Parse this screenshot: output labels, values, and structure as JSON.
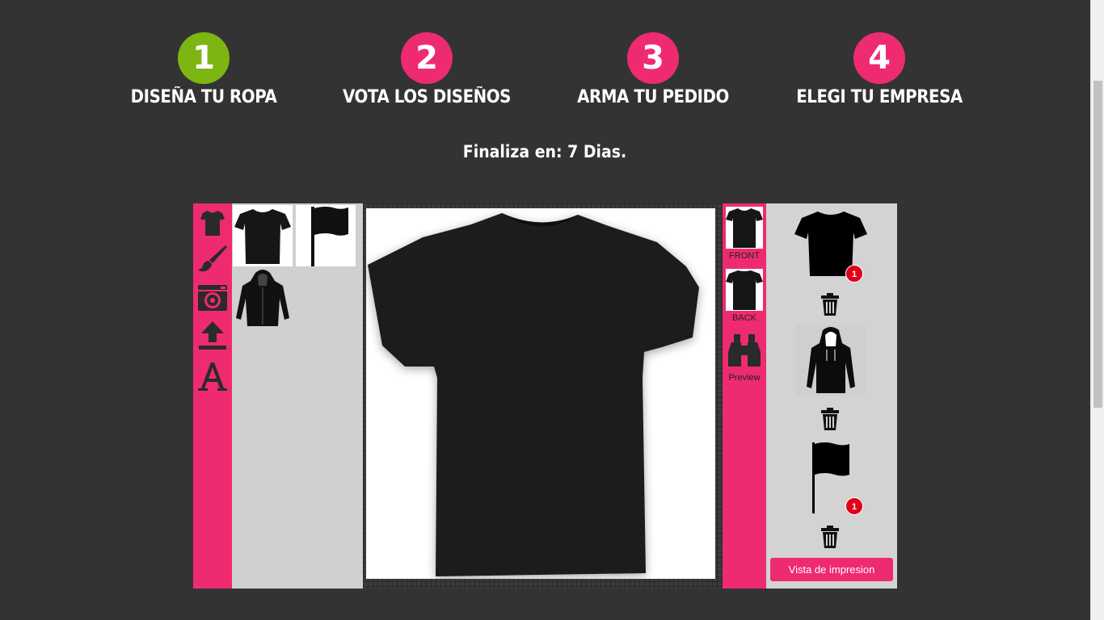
{
  "steps": [
    {
      "number": "1",
      "label": "DISEÑA TU ROPA"
    },
    {
      "number": "2",
      "label": "VOTA LOS DISEÑOS"
    },
    {
      "number": "3",
      "label": "ARMA TU PEDIDO"
    },
    {
      "number": "4",
      "label": "ELEGI TU EMPRESA"
    }
  ],
  "countdown": "Finaliza en: 7 Dias.",
  "toolbar": {
    "tools": [
      "tshirt-icon",
      "brush-icon",
      "camera-icon",
      "upload-icon",
      "text-icon"
    ]
  },
  "gallery": {
    "items": [
      "tshirt-thumb",
      "flag-thumb",
      "hoodie-thumb"
    ]
  },
  "views": {
    "front": "FRONT",
    "back": "BACK",
    "preview": "Preview"
  },
  "cart": {
    "items": [
      {
        "icon": "tshirt-icon",
        "badge": "1"
      },
      {
        "icon": "hoodie-icon",
        "badge": ""
      },
      {
        "icon": "flag-icon",
        "badge": "1"
      }
    ],
    "print_button": "Vista de impresion"
  },
  "colors": {
    "accent": "#ee2b70",
    "active_step": "#7db512",
    "background": "#333333",
    "badge": "#e0001a"
  }
}
